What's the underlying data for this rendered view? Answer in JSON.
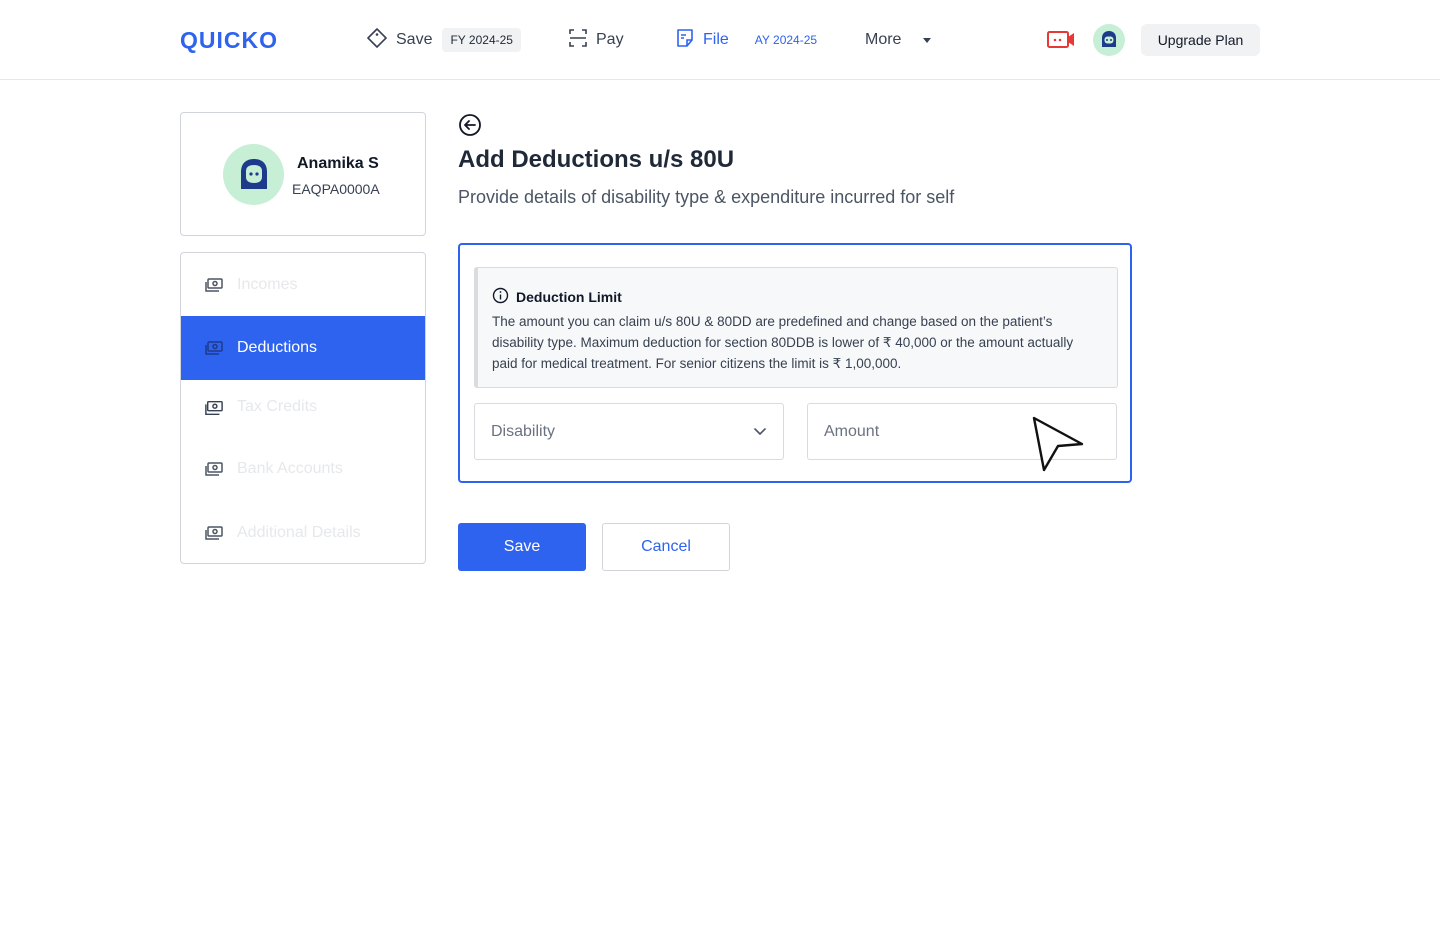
{
  "header": {
    "logo_text": "QUICKO",
    "nav": {
      "save_label": "Save",
      "save_badge": "FY 2024-25",
      "pay_label": "Pay",
      "file_label": "File",
      "file_badge": "AY 2024-25",
      "more_label": "More"
    },
    "upgrade_label": "Upgrade Plan",
    "icons": [
      "tag-icon",
      "scan-icon",
      "file-icon",
      "caret-down-icon",
      "video-icon",
      "bot-avatar-icon"
    ]
  },
  "profile": {
    "name": "Anamika S",
    "pan": "EAQPA0000A"
  },
  "sidebar": {
    "items": [
      {
        "label": "Incomes",
        "active": false
      },
      {
        "label": "Deductions",
        "active": true
      },
      {
        "label": "Tax Credits",
        "active": false
      },
      {
        "label": "Bank Accounts",
        "active": false
      },
      {
        "label": "Additional Details",
        "active": false
      }
    ]
  },
  "main": {
    "title": "Add Deductions u/s 80U",
    "subtitle": "Provide details of disability type & expenditure incurred for self",
    "info": {
      "title": "Deduction Limit",
      "text": "The amount you can claim u/s 80U & 80DD are predefined and change based on the patient’s disability type. Maximum deduction for section 80DDB is lower of ₹ 40,000 or the amount actually paid for medical treatment. For senior citizens the limit is ₹ 1,00,000."
    },
    "disability_select": {
      "placeholder": "Disability"
    },
    "amount_input": {
      "placeholder": "Amount",
      "value": ""
    },
    "save_label": "Save",
    "cancel_label": "Cancel"
  },
  "colors": {
    "accent": "#2e63f0",
    "avatar_bg": "#c6efd6",
    "video_icon": "#e53935"
  }
}
